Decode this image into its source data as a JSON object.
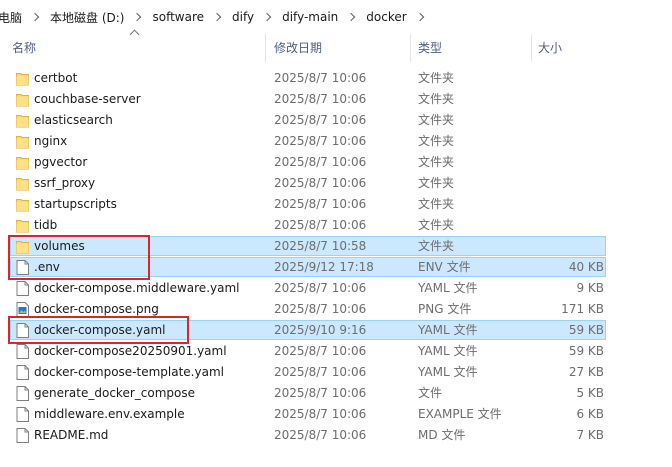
{
  "address_bar": {
    "crumbs": [
      "电脑",
      "本地磁盘 (D:)",
      "software",
      "dify",
      "dify-main",
      "docker"
    ]
  },
  "columns": {
    "name": "名称",
    "date": "修改日期",
    "type": "类型",
    "size": "大小"
  },
  "files": [
    {
      "name": "certbot",
      "date": "2025/8/7 10:06",
      "type": "文件夹",
      "size": "",
      "icon": "folder-icon",
      "selected": false
    },
    {
      "name": "couchbase-server",
      "date": "2025/8/7 10:06",
      "type": "文件夹",
      "size": "",
      "icon": "folder-icon",
      "selected": false
    },
    {
      "name": "elasticsearch",
      "date": "2025/8/7 10:06",
      "type": "文件夹",
      "size": "",
      "icon": "folder-icon",
      "selected": false
    },
    {
      "name": "nginx",
      "date": "2025/8/7 10:06",
      "type": "文件夹",
      "size": "",
      "icon": "folder-icon",
      "selected": false
    },
    {
      "name": "pgvector",
      "date": "2025/8/7 10:06",
      "type": "文件夹",
      "size": "",
      "icon": "folder-icon",
      "selected": false
    },
    {
      "name": "ssrf_proxy",
      "date": "2025/8/7 10:06",
      "type": "文件夹",
      "size": "",
      "icon": "folder-icon",
      "selected": false
    },
    {
      "name": "startupscripts",
      "date": "2025/8/7 10:06",
      "type": "文件夹",
      "size": "",
      "icon": "folder-icon",
      "selected": false
    },
    {
      "name": "tidb",
      "date": "2025/8/7 10:06",
      "type": "文件夹",
      "size": "",
      "icon": "folder-icon",
      "selected": false
    },
    {
      "name": "volumes",
      "date": "2025/8/7 10:58",
      "type": "文件夹",
      "size": "",
      "icon": "folder-icon",
      "selected": true
    },
    {
      "name": ".env",
      "date": "2025/9/12 17:18",
      "type": "ENV 文件",
      "size": "40 KB",
      "icon": "file-icon",
      "selected": true
    },
    {
      "name": "docker-compose.middleware.yaml",
      "date": "2025/8/7 10:06",
      "type": "YAML 文件",
      "size": "9 KB",
      "icon": "file-icon",
      "selected": false
    },
    {
      "name": "docker-compose.png",
      "date": "2025/8/7 10:06",
      "type": "PNG 文件",
      "size": "171 KB",
      "icon": "image-file-icon",
      "selected": false
    },
    {
      "name": "docker-compose.yaml",
      "date": "2025/9/10 9:16",
      "type": "YAML 文件",
      "size": "59 KB",
      "icon": "file-icon",
      "selected": true
    },
    {
      "name": "docker-compose20250901.yaml",
      "date": "2025/8/7 10:06",
      "type": "YAML 文件",
      "size": "59 KB",
      "icon": "file-icon",
      "selected": false
    },
    {
      "name": "docker-compose-template.yaml",
      "date": "2025/8/7 10:06",
      "type": "YAML 文件",
      "size": "27 KB",
      "icon": "file-icon",
      "selected": false
    },
    {
      "name": "generate_docker_compose",
      "date": "2025/8/7 10:06",
      "type": "文件",
      "size": "5 KB",
      "icon": "file-icon",
      "selected": false
    },
    {
      "name": "middleware.env.example",
      "date": "2025/8/7 10:06",
      "type": "EXAMPLE 文件",
      "size": "6 KB",
      "icon": "file-icon",
      "selected": false
    },
    {
      "name": "README.md",
      "date": "2025/8/7 10:06",
      "type": "MD 文件",
      "size": "7 KB",
      "icon": "file-icon",
      "selected": false
    }
  ],
  "colors": {
    "selection": "#cce8ff",
    "selection_border": "#99d1ff",
    "highlight_box": "#d9262c",
    "folder": "#ffd866",
    "header_text": "#4d6082"
  }
}
